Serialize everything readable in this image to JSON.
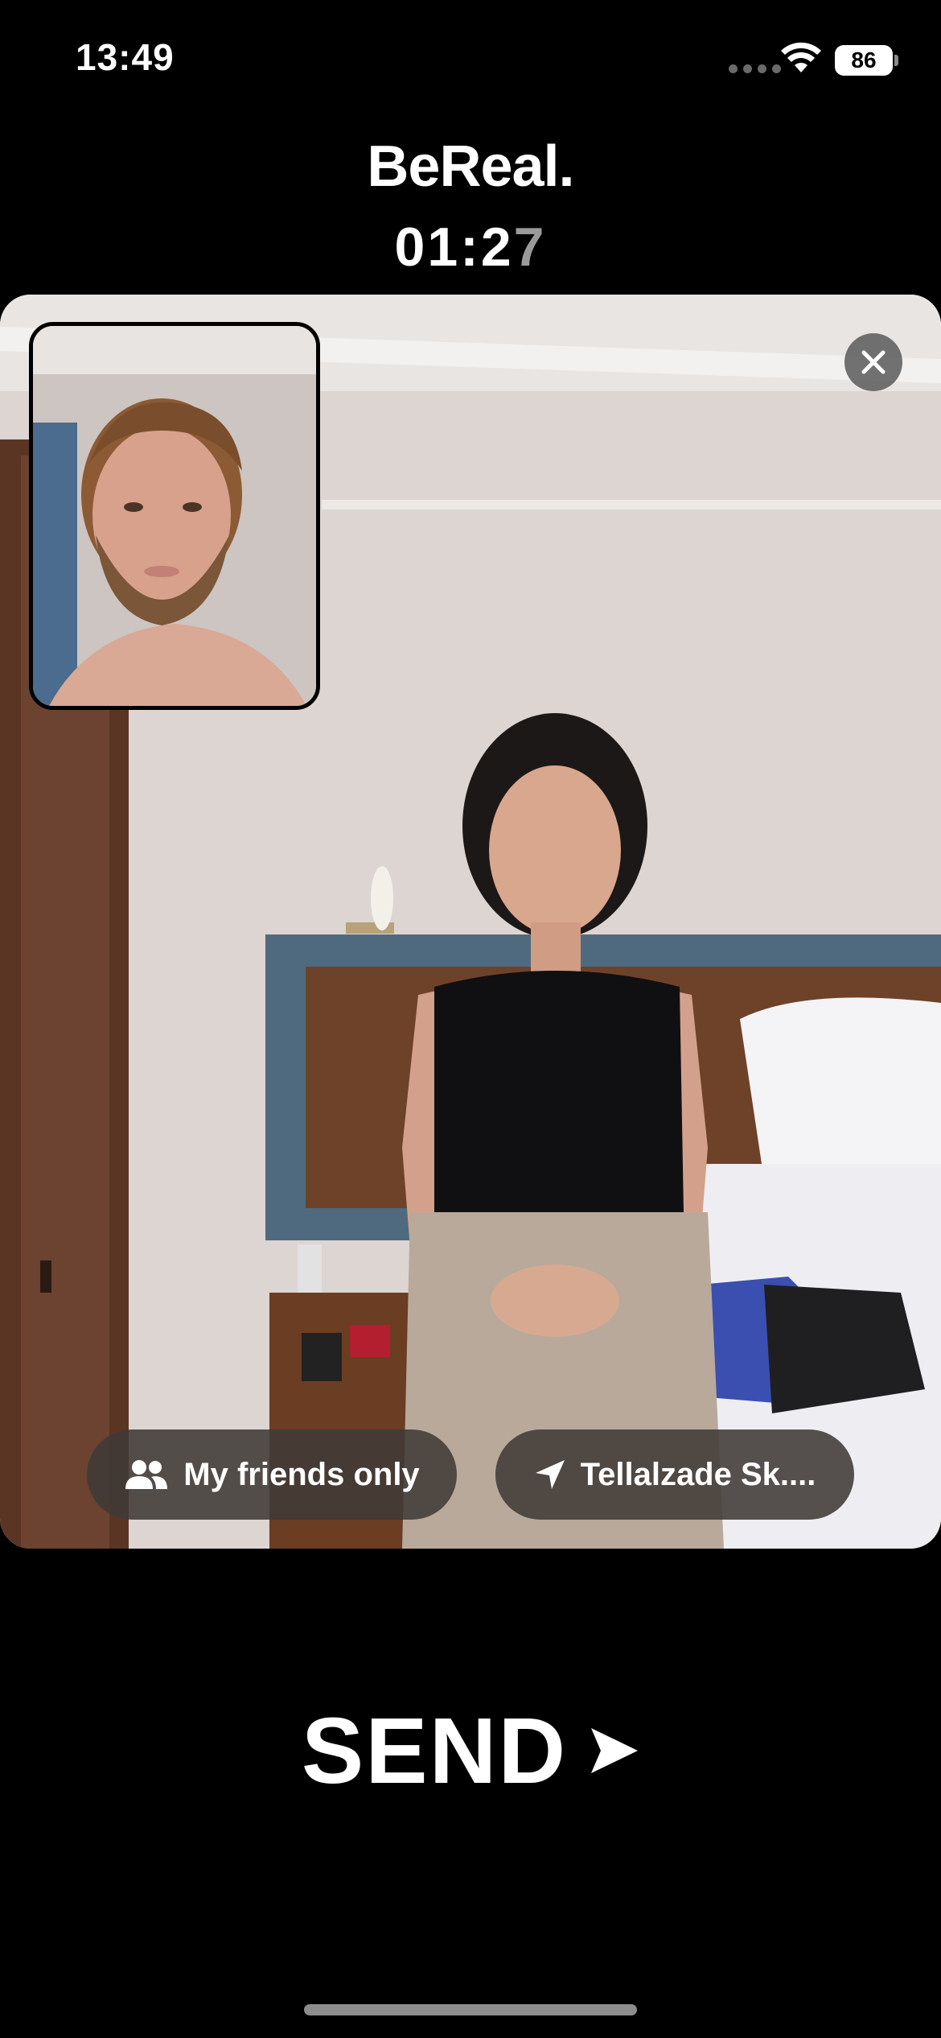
{
  "status_bar": {
    "time": "13:49",
    "battery": "86",
    "icons": [
      "cellular-signal-icon",
      "wifi-icon",
      "battery-icon"
    ]
  },
  "header": {
    "title": "BeReal.",
    "timer_main": "01:2",
    "timer_dim": "7"
  },
  "photo": {
    "main_description_icon": "back-camera-photo",
    "selfie_icon": "front-camera-photo",
    "close_icon": "close-icon"
  },
  "options": {
    "audience_label": "My friends only",
    "audience_icon": "people-icon",
    "location_label": "Tellalzade Sk....",
    "location_icon": "location-arrow-icon"
  },
  "send": {
    "label": "SEND",
    "icon": "send-arrow-icon"
  },
  "colors": {
    "background": "#000000",
    "text": "#ffffff",
    "timer_dim": "#9a9a9a",
    "pill_bg": "#403a37",
    "close_bg": "#5a5a5a"
  }
}
